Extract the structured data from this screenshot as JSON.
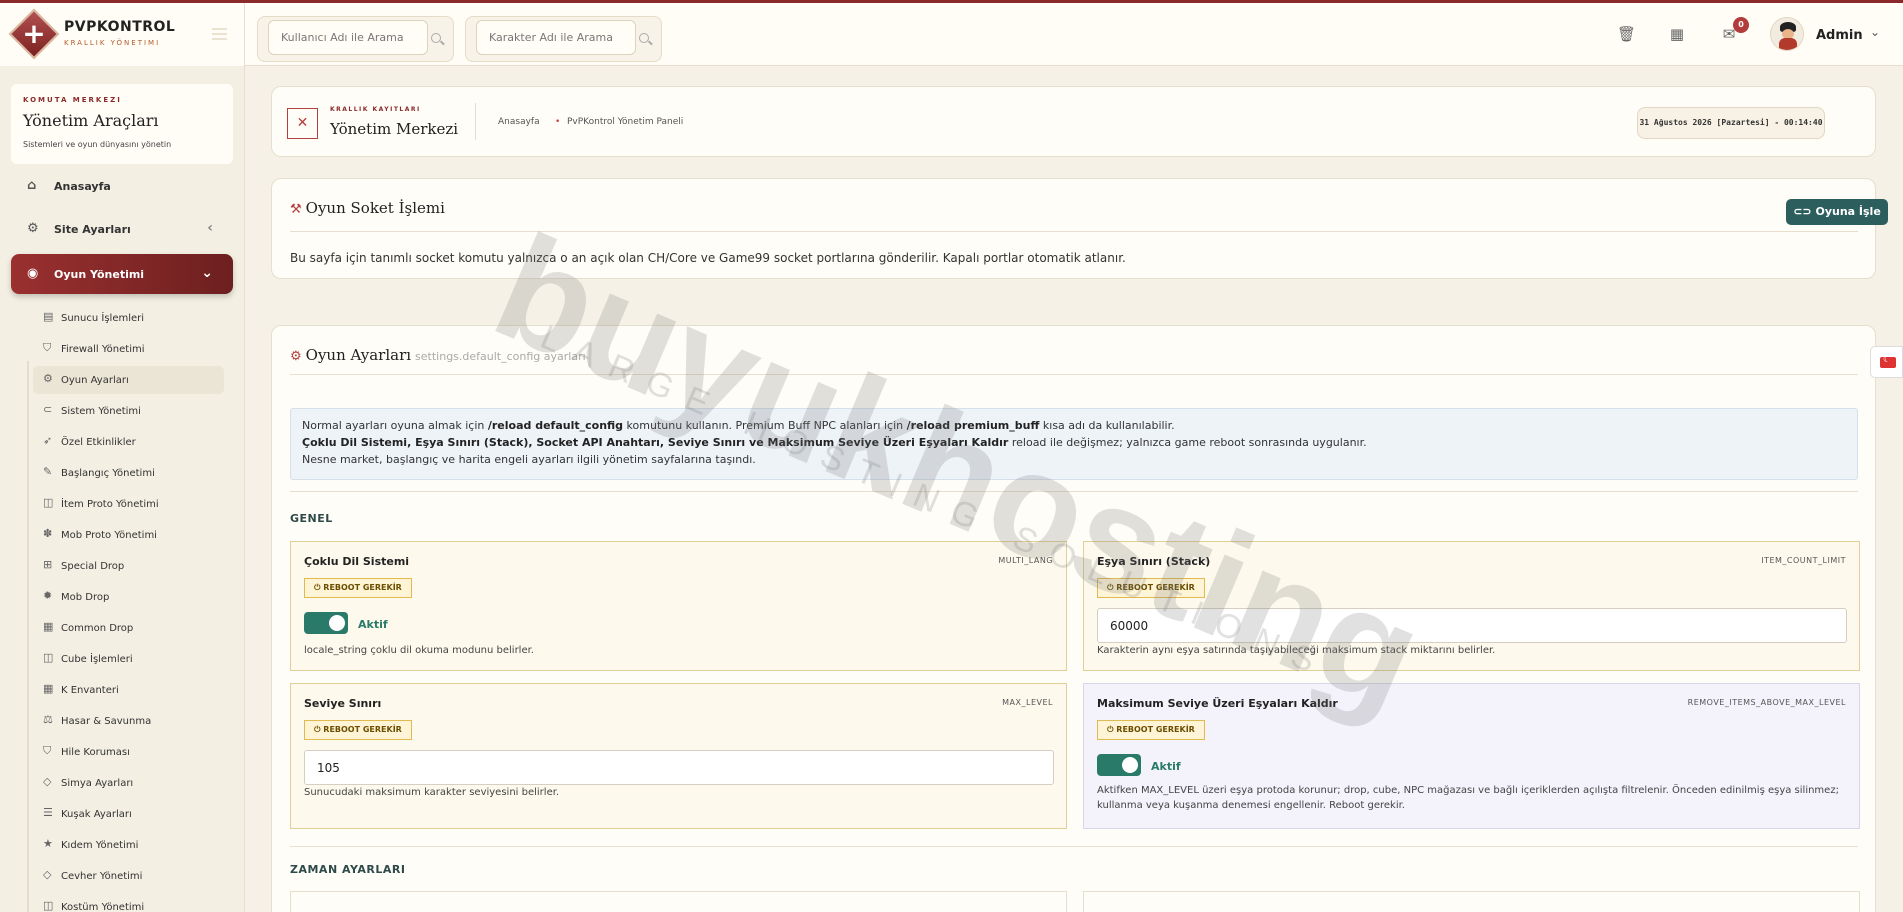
{
  "app": {
    "title": "PVPKONTROL",
    "subtitle": "KRALLIK YÖNETIMI"
  },
  "header": {
    "search_user_placeholder": "Kullanıcı Adı ile Arama",
    "search_char_placeholder": "Karakter Adı ile Arama",
    "mail_badge": "0",
    "user": "Admin"
  },
  "sidebar": {
    "kicker": "KOMUTA MERKEZI",
    "title": "Yönetim Araçları",
    "subtitle": "Sistemleri ve oyun dünyasını yönetin",
    "nav": [
      {
        "label": "Anasayfa",
        "icon": "home-icon"
      },
      {
        "label": "Site Ayarları",
        "icon": "gear-icon"
      },
      {
        "label": "Oyun Yönetimi",
        "icon": "gamepad-icon"
      }
    ],
    "sub": [
      "Sunucu İşlemleri",
      "Firewall Yönetimi",
      "Oyun Ayarları",
      "Sistem Yönetimi",
      "Özel Etkinlikler",
      "Başlangıç Yönetimi",
      "İtem Proto Yönetimi",
      "Mob Proto Yönetimi",
      "Special Drop",
      "Mob Drop",
      "Common Drop",
      "Cube İşlemleri",
      "K Envanteri",
      "Hasar & Savunma",
      "Hile Koruması",
      "Simya Ayarları",
      "Kuşak Ayarları",
      "Kıdem Yönetimi",
      "Cevher Yönetimi",
      "Kostüm Yönetimi"
    ]
  },
  "breadcrumb": {
    "kicker": "KRALLIK KAYITLARI",
    "title": "Yönetim Merkezi",
    "home": "Anasayfa",
    "page": "PvPKontrol Yönetim Paneli",
    "datetime": "31 Ağustos 2026 [Pazartesi] - 00:14:40"
  },
  "socket": {
    "title": "Oyun Soket İşlemi",
    "button": "Oyuna İşle",
    "text": "Bu sayfa için tanımlı socket komutu yalnızca o an açık olan CH/Core ve Game99 socket portlarına gönderilir. Kapalı portlar otomatik atlanır."
  },
  "settings": {
    "title": "Oyun Ayarları",
    "key": "settings.default_config ayarları",
    "info": {
      "l1a": "Normal ayarları oyuna almak için ",
      "l1b": "/reload default_config",
      "l1c": " komutunu kullanın. Premium Buff NPC alanları için ",
      "l1d": "/reload premium_buff",
      "l1e": " kısa adı da kullanılabilir.",
      "l2a": "Çoklu Dil Sistemi, Eşya Sınırı (Stack), Socket API Anahtarı, Seviye Sınırı ve Maksimum Seviye Üzeri Eşyaları Kaldır",
      "l2b": " reload ile değişmez; yalnızca game reboot sonrasında uygulanır.",
      "l3": "Nesne market, başlangıç ve harita engeli ayarları ilgili yönetim sayfalarına taşındı."
    },
    "section_general": "GENEL",
    "section_time": "ZAMAN AYARLARI",
    "reboot": "REBOOT GEREKİR",
    "active": "Aktif",
    "options": [
      {
        "name": "Çoklu Dil Sistemi",
        "key": "MULTI_LANG",
        "desc": "locale_string çoklu dil okuma modunu belirler."
      },
      {
        "name": "Eşya Sınırı (Stack)",
        "key": "ITEM_COUNT_LIMIT",
        "value": "60000",
        "desc": "Karakterin aynı eşya satırında taşıyabileceği maksimum stack miktarını belirler."
      },
      {
        "name": "Seviye Sınırı",
        "key": "MAX_LEVEL",
        "value": "105",
        "desc": "Sunucudaki maksimum karakter seviyesini belirler."
      },
      {
        "name": "Maksimum Seviye Üzeri Eşyaları Kaldır",
        "key": "REMOVE_ITEMS_ABOVE_MAX_LEVEL",
        "desc": "Aktifken MAX_LEVEL üzeri eşya protoda korunur; drop, cube, NPC mağazası ve bağlı içeriklerden açılışta filtrelenir. Önceden edinilmiş eşya silinmez; kullanma veya kuşanma denemesi engellenir. Reboot gerekir."
      }
    ]
  },
  "watermark": {
    "brand": "buyukhosting",
    "tagline": "LARGE HOSTING SOLUTIONS"
  }
}
